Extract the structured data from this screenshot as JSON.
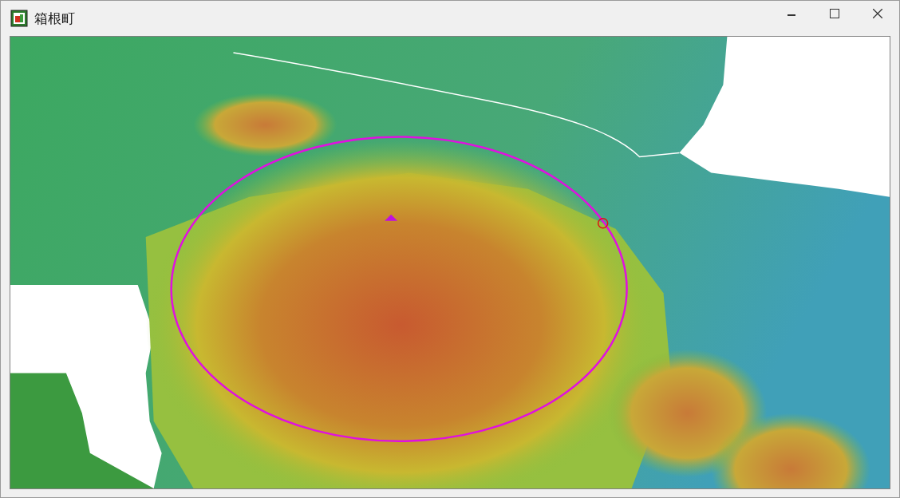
{
  "window": {
    "title": "箱根町"
  }
}
